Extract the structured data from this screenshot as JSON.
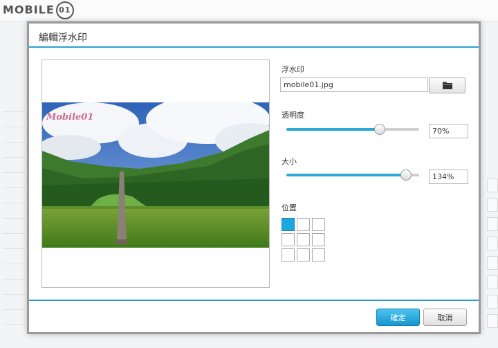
{
  "background": {
    "logo_text": "MOBILE",
    "logo_badge": "01"
  },
  "dialog": {
    "title": "編輯浮水印",
    "preview": {
      "watermark_text": "Mobile01"
    },
    "watermark_section": {
      "label": "浮水印",
      "filename_value": "mobile01.jpg",
      "browse_icon": "folder-icon"
    },
    "opacity_section": {
      "label": "透明度",
      "value_text": "70%",
      "value": 70
    },
    "size_section": {
      "label": "大小",
      "value_text": "134%",
      "value": 134
    },
    "position_section": {
      "label": "位置",
      "selected_cell": 0
    },
    "buttons": {
      "ok_label": "確定",
      "cancel_label": "取消"
    },
    "colors": {
      "accent": "#2aa1cf",
      "ok_button": "#1aa8e0",
      "selected_position": "#1aa8e0"
    }
  }
}
